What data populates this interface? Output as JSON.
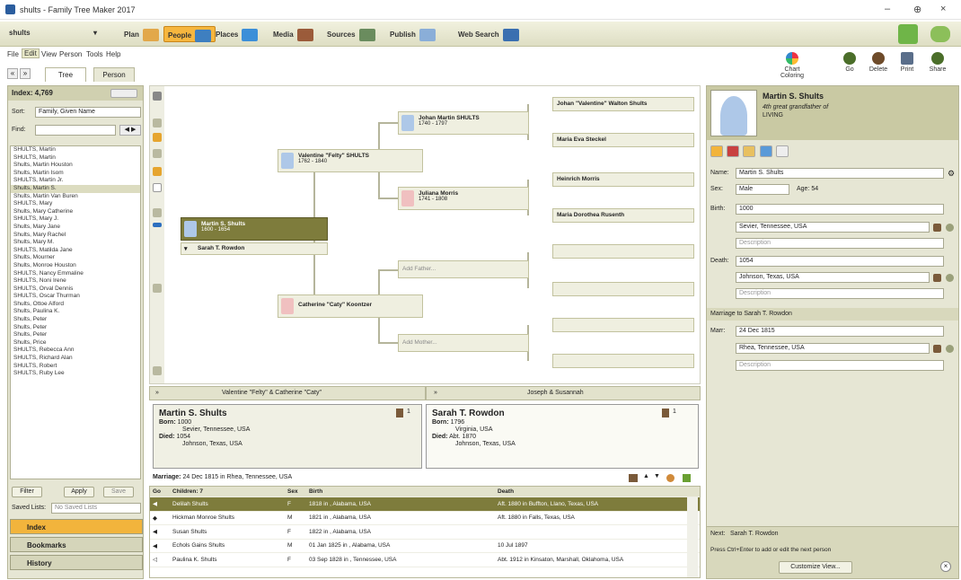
{
  "window": {
    "title": "shults - Family Tree Maker 2017",
    "minimize": "–",
    "maximize": "⊕",
    "close": "×"
  },
  "workspaces": [
    {
      "label": "shults",
      "dropdown": "▾"
    },
    {
      "label": "Plan",
      "color": "#e2a84a"
    },
    {
      "label": "People",
      "color": "#3e7fc0",
      "active": true
    },
    {
      "label": "Places",
      "color": "#3c8fd8"
    },
    {
      "label": "Media",
      "color": "#9b5b3a"
    },
    {
      "label": "Sources",
      "color": "#6a8c5e"
    },
    {
      "label": "Publish",
      "color": "#8aaed8"
    },
    {
      "label": "Web Search",
      "color": "#3a6fb0"
    }
  ],
  "menu": [
    "File",
    "Edit",
    "View",
    "Person",
    "Tools",
    "Help"
  ],
  "menu_selected": "Edit",
  "people_tabs": [
    "Tree",
    "Person"
  ],
  "toolbar": [
    {
      "label": "Chart Coloring",
      "icon": "color-wheel-icon",
      "color": "#d88a3a"
    },
    {
      "label": "Go",
      "icon": "person-go-icon",
      "color": "#4b6e2a"
    },
    {
      "label": "Delete",
      "icon": "person-delete-icon",
      "color": "#6e4b2a"
    },
    {
      "label": "Print",
      "icon": "print-icon",
      "color": "#5a6e8a"
    },
    {
      "label": "Share",
      "icon": "share-icon",
      "color": "#4b6e2a"
    }
  ],
  "index": {
    "header": "Index: 4,769",
    "sort_label": "Sort:",
    "sort_value": "Family, Given Name",
    "find_label": "Find:",
    "names": [
      "SHULTS, Martin",
      "SHULTS, Martin",
      "Shults, Martin Houston",
      "Shults, Martin Isom",
      "SHULTS, Martin Jr.",
      "Shults, Martin S.",
      "Shults, Martin Van Buren",
      "SHULTS, Mary",
      "Shults, Mary Catherine",
      "SHULTS, Mary J.",
      "Shults, Mary Jane",
      "Shults, Mary Rachel",
      "Shults, Mary M.",
      "SHULTS, Matilda Jane",
      "Shults, Mourner",
      "Shults, Monroe Houston",
      "SHULTS, Nancy Emmaline",
      "SHULTS, Noni Irene",
      "SHULTS, Orval Dennis",
      "SHULTS, Oscar Thurman",
      "Shults, Ottoe Alford",
      "Shults, Paulina K.",
      "Shults, Peter",
      "Shults, Peter",
      "Shults, Peter",
      "Shults, Price",
      "SHULTS, Rebecca Ann",
      "SHULTS, Richard Alan",
      "SHULTS, Robert",
      "SHULTS, Ruby Lee"
    ],
    "selected_index": 5,
    "filter": "Filter",
    "apply": "Apply",
    "save": "Save",
    "saved_lists_label": "Saved Lists:",
    "saved_lists_value": "No Saved Lists",
    "nav": [
      "Index",
      "Bookmarks",
      "History"
    ]
  },
  "tree": {
    "root": {
      "name": "Martin S. Shults",
      "dates": "1600 - 1654"
    },
    "spouse": "Sarah T. Rowdon",
    "father": {
      "name": "Valentine \"Felty\" SHULTS",
      "dates": "1762 - 1840"
    },
    "mother": {
      "name": "Catherine \"Caty\" Koontzer"
    },
    "pgf": {
      "name": "Johan Martin SHULTS",
      "dates": "1740 - 1797"
    },
    "pgm": {
      "name": "Juliana Morris",
      "dates": "1741 - 1808"
    },
    "pggf": "Johan \"Valentine\" Walton Shults",
    "pggm": "Maria Eva Steckel",
    "pgmf": "Heinrich Morris",
    "pgmm": "Maria Dorothea Rusenth",
    "add_father": "Add Father...",
    "add_mother": "Add Mother..."
  },
  "family": {
    "parents_header_left": "Valentine \"Felty\" & Catherine \"Caty\"",
    "parents_header_right": "Joseph & Susannah",
    "person": {
      "name": "Martin S. Shults",
      "born_label": "Born:",
      "born_date": "1000",
      "born_place": "Sevier, Tennessee, USA",
      "died_label": "Died:",
      "died_date": "1054",
      "died_place": "Johnson, Texas, USA",
      "counter": "1"
    },
    "spouse": {
      "name": "Sarah T. Rowdon",
      "born_label": "Born:",
      "born_date": "1796",
      "born_place": "Virginia, USA",
      "died_label": "Died:",
      "died_date": "Abt. 1870",
      "died_place": "Johnson, Texas, USA",
      "counter": "1"
    },
    "marriage_label": "Marriage:",
    "marriage_value": "24 Dec 1815 in Rhea, Tennessee, USA",
    "children_headers": [
      "Go",
      "Children: 7",
      "Sex",
      "Birth",
      "Death"
    ],
    "children": [
      {
        "go": "◀",
        "name": "Delilah Shults",
        "sex": "F",
        "birth": "1818 in , Alabama, USA",
        "death": "Aft. 1880 in Buffton, Llano, Texas, USA"
      },
      {
        "go": "◆",
        "name": "Hickman Monroe Shults",
        "sex": "M",
        "birth": "1821 in , Alabama, USA",
        "death": "Aft. 1880 in Falls, Texas, USA"
      },
      {
        "go": "◀",
        "name": "Susan Shults",
        "sex": "F",
        "birth": "1822 in , Alabama, USA",
        "death": ""
      },
      {
        "go": "◀",
        "name": "Echols Gains Shults",
        "sex": "M",
        "birth": "01 Jan 1825 in , Alabama, USA",
        "death": "10 Jul 1897"
      },
      {
        "go": "◁",
        "name": "Paulina K. Shults",
        "sex": "F",
        "birth": "03 Sep 1828 in , Tennessee, USA",
        "death": "Abt. 1912 in Kinsaton, Marshall, Oklahoma, USA"
      }
    ],
    "selected_child": 0
  },
  "editor": {
    "name": "Martin S. Shults",
    "relation": "4th great grandfather of",
    "status": "LIVING",
    "name_label": "Name:",
    "name_value": "Martin S. Shults",
    "sex_label": "Sex:",
    "sex_value": "Male",
    "age_label": "Age: 54",
    "birth_label": "Birth:",
    "birth_date": "1000",
    "birth_place": "Sevier, Tennessee, USA",
    "birth_desc": "Description",
    "death_label": "Death:",
    "death_date": "1054",
    "death_place": "Johnson, Texas, USA",
    "death_desc": "Description",
    "marriage_header": "Marriage to Sarah T. Rowdon",
    "marr_label": "Marr:",
    "marr_date": "24 Dec 1815",
    "marr_place": "Rhea, Tennessee, USA",
    "marr_desc": "Description",
    "next_label": "Next:",
    "next_value": "Sarah T. Rowdon",
    "hint": "Press Ctrl+Enter to add or edit the next person",
    "customize": "Customize View..."
  }
}
